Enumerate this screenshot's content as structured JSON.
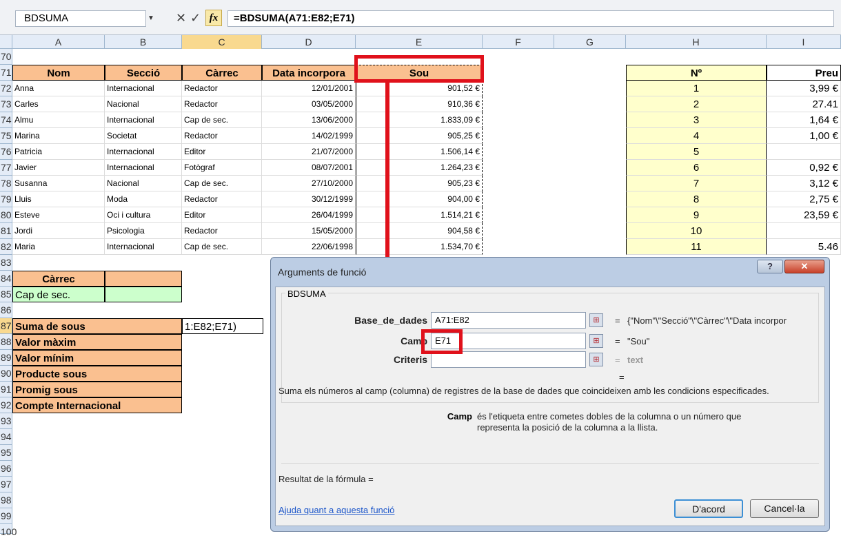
{
  "formula_bar": {
    "name_box": "BDSUMA",
    "cancel": "✕",
    "enter": "✓",
    "fx": "fx",
    "formula": "=BDSUMA(A71:E82;E71)"
  },
  "columns": [
    "A",
    "B",
    "C",
    "D",
    "E",
    "F",
    "G",
    "H",
    "I"
  ],
  "rows": [
    "70",
    "71",
    "72",
    "73",
    "74",
    "75",
    "76",
    "77",
    "78",
    "79",
    "80",
    "81",
    "82",
    "83",
    "84",
    "85",
    "86",
    "87",
    "88",
    "89",
    "90",
    "91",
    "92",
    "93",
    "94",
    "95",
    "96",
    "97",
    "98",
    "99",
    "100"
  ],
  "table": {
    "headers": [
      "Nom",
      "Secció",
      "Càrrec",
      "Data incorpora",
      "Sou"
    ],
    "records": [
      [
        "Anna",
        "Internacional",
        "Redactor",
        "12/01/2001",
        "901,52 €"
      ],
      [
        "Carles",
        "Nacional",
        "Redactor",
        "03/05/2000",
        "910,36 €"
      ],
      [
        "Almu",
        "Internacional",
        "Cap de sec.",
        "13/06/2000",
        "1.833,09 €"
      ],
      [
        "Marina",
        "Societat",
        "Redactor",
        "14/02/1999",
        "905,25 €"
      ],
      [
        "Patricia",
        "Internacional",
        "Editor",
        "21/07/2000",
        "1.506,14 €"
      ],
      [
        "Javier",
        "Internacional",
        "Fotògraf",
        "08/07/2001",
        "1.264,23 €"
      ],
      [
        "Susanna",
        "Nacional",
        "Cap de sec.",
        "27/10/2000",
        "905,23 €"
      ],
      [
        "Lluis",
        "Moda",
        "Redactor",
        "30/12/1999",
        "904,00 €"
      ],
      [
        "Esteve",
        "Oci i cultura",
        "Editor",
        "26/04/1999",
        "1.514,21 €"
      ],
      [
        "Jordi",
        "Psicologia",
        "Redactor",
        "15/05/2000",
        "904,58 €"
      ],
      [
        "Maria",
        "Internacional",
        "Cap de sec.",
        "22/06/1998",
        "1.534,70 €"
      ]
    ]
  },
  "criteria": {
    "header": "Càrrec",
    "value": "Cap de sec."
  },
  "summary": {
    "labels": [
      "Suma de sous",
      "Valor màxim",
      "Valor mínim",
      "Producte sous",
      "Promig sous",
      "Compte Internacional"
    ],
    "edit_text": "1:E82;E71)"
  },
  "side_table": {
    "n_header": "Nº",
    "price_header": "Preu",
    "n": [
      "1",
      "2",
      "3",
      "4",
      "5",
      "6",
      "7",
      "8",
      "9",
      "10",
      "11"
    ],
    "prices": [
      "3,99 €",
      "27.41",
      "1,64 €",
      "1,00 €",
      "",
      "0,92 €",
      "3,12 €",
      "2,75 €",
      "23,59 €",
      "",
      "5.46"
    ]
  },
  "dialog": {
    "title": "Arguments de funció",
    "help": "?",
    "close": "✕",
    "function_name": "BDSUMA",
    "args": [
      {
        "label": "Base_de_dades",
        "value": "A71:E82",
        "result": "{\"Nom\"\\\"Secció\"\\\"Càrrec\"\\\"Data incorpor"
      },
      {
        "label": "Camp",
        "value": "E71",
        "result": "\"Sou\""
      },
      {
        "label": "Criteris",
        "value": "",
        "result": "text"
      }
    ],
    "eq": "=",
    "result_eq": "=",
    "description": "Suma els números al camp (columna) de registres de la base de dades que coincideixen amb les condicions especificades.",
    "arg_desc_label": "Camp",
    "arg_desc_text": "és l'etiqueta entre cometes dobles de la columna o un número que representa la posició de la columna a la llista.",
    "formula_result": "Resultat de la fórmula =",
    "help_link": "Ajuda quant a aquesta funció",
    "ok": "D'acord",
    "cancel": "Cancel·la"
  },
  "colors": {
    "accent_red": "#e0111b",
    "header_orange": "#fac090",
    "criteria_green": "#ccffcc",
    "side_yellow": "#ffffcc"
  }
}
